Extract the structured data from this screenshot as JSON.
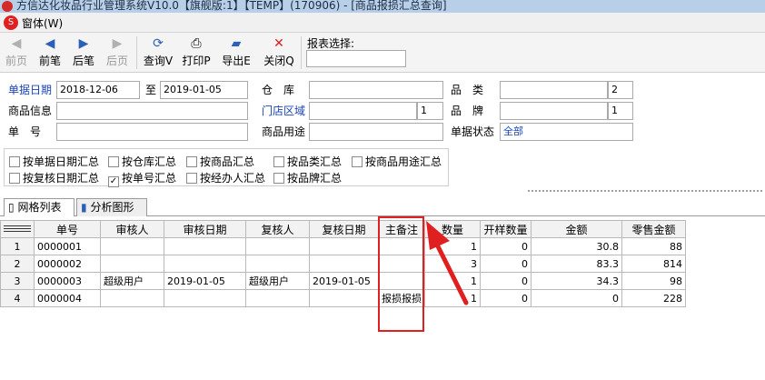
{
  "window": {
    "title": "方信达化妆品行业管理系统V10.0【旗舰版:1】【TEMP】(170906) - [商品报损汇总查询]",
    "menu_item": "窗体(W)",
    "menu_logo": "S"
  },
  "toolbar": {
    "buttons": [
      {
        "label": "前页",
        "icon": "first-page-icon",
        "glyph": "◀",
        "disabled": true
      },
      {
        "label": "前笔",
        "icon": "previous-record-icon",
        "glyph": "◀",
        "disabled": false
      },
      {
        "label": "后笔",
        "icon": "next-record-icon",
        "glyph": "▶",
        "disabled": false
      },
      {
        "label": "后页",
        "icon": "last-page-icon",
        "glyph": "▶",
        "disabled": true
      },
      {
        "label": "查询V",
        "icon": "query-icon",
        "glyph": "⟳",
        "disabled": false
      },
      {
        "label": "打印P",
        "icon": "printer-icon",
        "glyph": "⎙",
        "disabled": false
      },
      {
        "label": "导出E",
        "icon": "export-icon",
        "glyph": "▰",
        "disabled": false
      },
      {
        "label": "关闭Q",
        "icon": "close-icon",
        "glyph": "✕",
        "disabled": false
      }
    ],
    "report_select_label": "报表选择:",
    "report_select_value": ""
  },
  "filters": {
    "date_label": "单据日期",
    "date_from": "2018-12-06",
    "to_label": "至",
    "date_to": "2019-01-05",
    "warehouse_label": "仓　库",
    "warehouse_value": "",
    "category_label": "品　类",
    "category_value": "",
    "category_count": "2",
    "product_info_label": "商品信息",
    "product_info_value": "",
    "store_area_label": "门店区域",
    "store_area_value": "",
    "store_area_count": "1",
    "brand_label": "品　牌",
    "brand_value": "",
    "brand_count": "1",
    "doc_no_label": "单　号",
    "doc_no_value": "",
    "product_use_label": "商品用途",
    "product_use_value": "",
    "doc_status_label": "单据状态",
    "doc_status_value": "全部"
  },
  "checkboxes": [
    {
      "label": "按单据日期汇总",
      "checked": false
    },
    {
      "label": "按仓库汇总",
      "checked": false
    },
    {
      "label": "按商品汇总",
      "checked": false
    },
    {
      "label": "按品类汇总",
      "checked": false
    },
    {
      "label": "按商品用途汇总",
      "checked": false
    },
    {
      "label": "按复核日期汇总",
      "checked": false
    },
    {
      "label": "按单号汇总",
      "checked": true
    },
    {
      "label": "按经办人汇总",
      "checked": false
    },
    {
      "label": "按品牌汇总",
      "checked": false
    }
  ],
  "tabs": {
    "grid": "网格列表",
    "chart": "分析图形"
  },
  "grid": {
    "columns": [
      "单号",
      "审核人",
      "审核日期",
      "复核人",
      "复核日期",
      "主备注",
      "数量",
      "开样数量",
      "金额",
      "零售金额"
    ],
    "rows": [
      {
        "no": "1",
        "cells": [
          "0000001",
          "",
          "",
          "",
          "",
          "",
          "1",
          "0",
          "30.8",
          "88"
        ]
      },
      {
        "no": "2",
        "cells": [
          "0000002",
          "",
          "",
          "",
          "",
          "",
          "3",
          "0",
          "83.3",
          "814"
        ]
      },
      {
        "no": "3",
        "cells": [
          "0000003",
          "超级用户",
          "2019-01-05",
          "超级用户",
          "2019-01-05",
          "",
          "1",
          "0",
          "34.3",
          "98"
        ]
      },
      {
        "no": "4",
        "cells": [
          "0000004",
          "",
          "",
          "",
          "",
          "报损报损",
          "1",
          "0",
          "0",
          "228"
        ]
      }
    ]
  },
  "colors": {
    "annotation_red": "#e02020",
    "link_blue": "#1a44b8"
  }
}
